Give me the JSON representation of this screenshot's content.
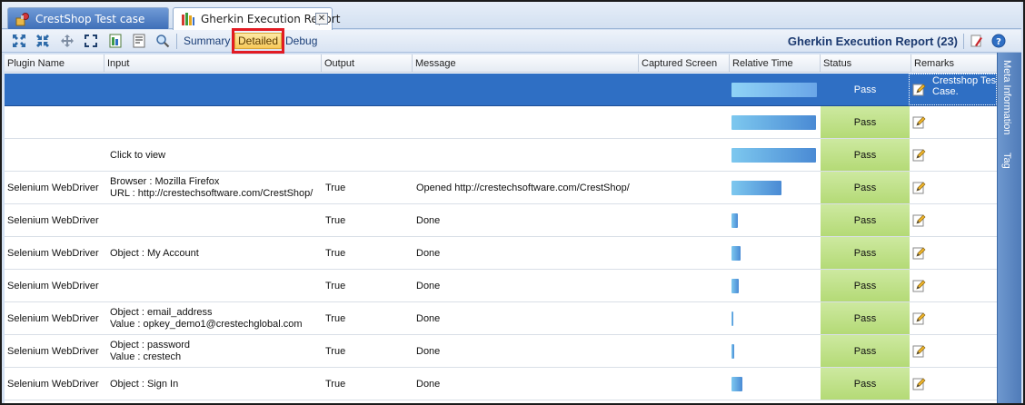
{
  "tabs": [
    {
      "label": "CrestShop Test case",
      "active": false
    },
    {
      "label": "Gherkin Execution Report",
      "active": true,
      "close": "✕"
    }
  ],
  "toolbar": {
    "buttons": [
      "Summary",
      "Detailed",
      "Debug"
    ],
    "selected": "Detailed",
    "report_title": "Gherkin Execution Report (23)"
  },
  "columns": [
    "Plugin Name",
    "Input",
    "Output",
    "Message",
    "Captured Screen",
    "Relative Time",
    "Status",
    "Remarks"
  ],
  "rows": [
    {
      "plugin": "",
      "input": [
        "",
        ""
      ],
      "output": "",
      "message": "",
      "time": 0.98,
      "status": "Pass",
      "remarks": [
        "Crestshop Tes",
        "Case."
      ],
      "selected": true
    },
    {
      "plugin": "",
      "input": [
        "",
        ""
      ],
      "output": "",
      "message": "",
      "time": 0.97,
      "status": "Pass",
      "remarks": [
        "",
        ""
      ],
      "selected": false
    },
    {
      "plugin": "",
      "input": [
        "Click to view",
        ""
      ],
      "output": "",
      "message": "",
      "time": 0.97,
      "status": "Pass",
      "remarks": [
        "",
        ""
      ],
      "selected": false
    },
    {
      "plugin": "Selenium WebDriver",
      "input": [
        "Browser : Mozilla Firefox",
        "URL : http://crestechsoftware.com/CrestShop/"
      ],
      "output": "True",
      "message": "Opened http://crestechsoftware.com/CrestShop/",
      "time": 0.57,
      "status": "Pass",
      "remarks": [
        "",
        ""
      ],
      "selected": false
    },
    {
      "plugin": "Selenium WebDriver",
      "input": [
        "",
        ""
      ],
      "output": "True",
      "message": "Done",
      "time": 0.07,
      "status": "Pass",
      "remarks": [
        "",
        ""
      ],
      "selected": false
    },
    {
      "plugin": "Selenium WebDriver",
      "input": [
        "Object : My Account",
        ""
      ],
      "output": "True",
      "message": "Done",
      "time": 0.1,
      "status": "Pass",
      "remarks": [
        "",
        ""
      ],
      "selected": false
    },
    {
      "plugin": "Selenium WebDriver",
      "input": [
        "",
        ""
      ],
      "output": "True",
      "message": "Done",
      "time": 0.08,
      "status": "Pass",
      "remarks": [
        "",
        ""
      ],
      "selected": false
    },
    {
      "plugin": "Selenium WebDriver",
      "input": [
        "Object : email_address",
        "Value : opkey_demo1@crestechglobal.com"
      ],
      "output": "True",
      "message": "Done",
      "time": 0.02,
      "status": "Pass",
      "remarks": [
        "",
        ""
      ],
      "selected": false
    },
    {
      "plugin": "Selenium WebDriver",
      "input": [
        "Object : password",
        "Value : crestech"
      ],
      "output": "True",
      "message": "Done",
      "time": 0.03,
      "status": "Pass",
      "remarks": [
        "",
        ""
      ],
      "selected": false
    },
    {
      "plugin": "Selenium WebDriver",
      "input": [
        "Object : Sign In",
        ""
      ],
      "output": "True",
      "message": "Done",
      "time": 0.13,
      "status": "Pass",
      "remarks": [
        "",
        ""
      ],
      "selected": false
    }
  ],
  "side_panel": [
    "Meta Information",
    "Tag"
  ]
}
